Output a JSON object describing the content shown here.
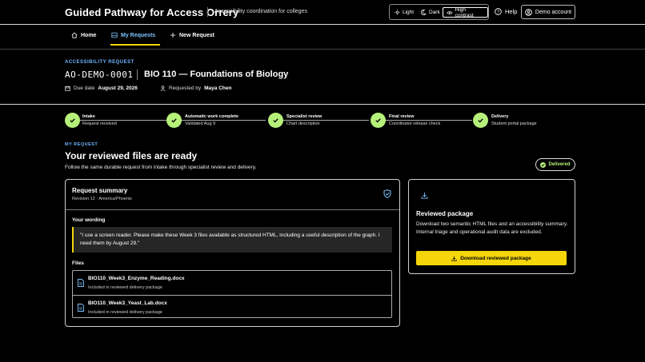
{
  "header": {
    "app_title": "Guided Pathway for Access Orrery",
    "app_subtitle": "Accessibility coordination for colleges",
    "theme": {
      "light": "Light",
      "dark": "Dark",
      "high_contrast": "High contrast"
    },
    "help": "Help",
    "account": "Demo account"
  },
  "nav": {
    "home": "Home",
    "my_requests": "My Requests",
    "new_request": "New Request"
  },
  "request": {
    "eyebrow": "ACCESSIBILITY REQUEST",
    "id": "AO-DEMO-0001",
    "course": "BIO 110 — Foundations of Biology",
    "due_label": "Due date",
    "due_value": "August 29, 2026",
    "requested_label": "Requested by",
    "requested_value": "Maya Chen"
  },
  "steps": [
    {
      "title": "Intake",
      "sub": "Request received"
    },
    {
      "title": "Automatic work complete",
      "sub": "Validated Aug 9"
    },
    {
      "title": "Specialist review",
      "sub": "Chart description"
    },
    {
      "title": "Final review",
      "sub": "Coordinator release check"
    },
    {
      "title": "Delivery",
      "sub": "Student portal package"
    }
  ],
  "section": {
    "eyebrow": "MY REQUEST",
    "title": "Your reviewed files are ready",
    "desc": "Follow the same durable request from intake through specialist review and delivery.",
    "status": "Delivered"
  },
  "summary": {
    "title": "Request summary",
    "revision": "Revision 12 · America/Phoenix",
    "wording_label": "Your wording",
    "wording": "\"I use a screen reader. Please make these Week 3 files available as structured HTML, including a useful description of the graph. I need them by August 29.\"",
    "files_label": "Files",
    "files": [
      {
        "name": "BIO110_Week3_Enzyme_Reading.docx",
        "desc": "Included in reviewed delivery package"
      },
      {
        "name": "BIO110_Week3_Yeast_Lab.docx",
        "desc": "Included in reviewed delivery package"
      }
    ]
  },
  "package": {
    "title": "Reviewed package",
    "desc": "Download two semantic HTML files and an accessibility summary. Internal triage and operational audit data are excluded.",
    "button": "Download reviewed package"
  },
  "colors": {
    "accent_yellow": "#f5d60a",
    "success_green": "#b6f07a",
    "link_blue": "#6fb6ff"
  }
}
